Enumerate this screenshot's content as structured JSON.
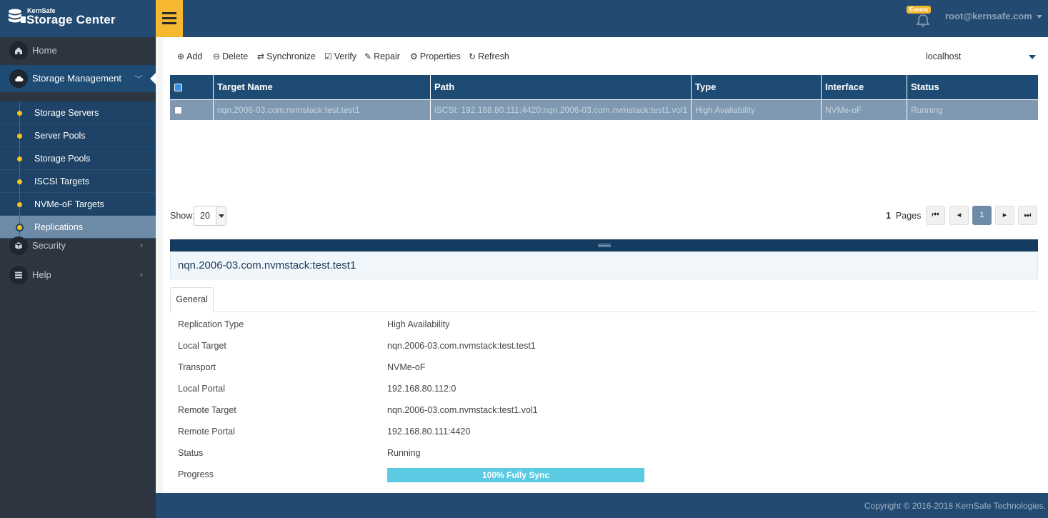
{
  "brand": {
    "small": "KernSafe",
    "title": "Storage Center"
  },
  "header": {
    "events_label": "Events",
    "user": "root@kernsafe.com"
  },
  "sidebar": {
    "items": [
      {
        "label": "Home",
        "icon": "home-icon"
      },
      {
        "label": "Storage Management",
        "icon": "cloud-icon"
      },
      {
        "label": "Security",
        "icon": "cube-icon"
      },
      {
        "label": "Help",
        "icon": "list-icon"
      }
    ],
    "subitems": [
      {
        "label": "Storage Servers"
      },
      {
        "label": "Server Pools"
      },
      {
        "label": "Storage Pools"
      },
      {
        "label": "ISCSI Targets"
      },
      {
        "label": "NVMe-oF Targets"
      },
      {
        "label": "Replications"
      }
    ]
  },
  "toolbar": {
    "add": "Add",
    "delete": "Delete",
    "synchronize": "Synchronize",
    "verify": "Verify",
    "repair": "Repair",
    "properties": "Properties",
    "refresh": "Refresh",
    "host": "localhost"
  },
  "table": {
    "columns": [
      "Target Name",
      "Path",
      "Type",
      "Interface",
      "Status"
    ],
    "rows": [
      {
        "target_name": "nqn.2006-03.com.nvmstack:test.test1",
        "path": "iSCSI: 192.168.80.111:4420:nqn.2006-03.com.nvmstack:test1.vol1",
        "type": "High Availability",
        "interface": "NVMe-oF",
        "status": "Running"
      }
    ]
  },
  "pager": {
    "show_label": "Show:",
    "page_size": "20",
    "page_count": "1",
    "pages_label": "Pages",
    "current_page": "1"
  },
  "detail": {
    "title": "nqn.2006-03.com.nvmstack:test.test1",
    "tab": "General",
    "props": [
      {
        "k": "Replication Type",
        "v": "High Availability"
      },
      {
        "k": "Local Target",
        "v": "nqn.2006-03.com.nvmstack:test.test1"
      },
      {
        "k": "Transport",
        "v": "NVMe-oF"
      },
      {
        "k": "Local Portal",
        "v": "192.168.80.112:0"
      },
      {
        "k": "Remote Target",
        "v": "nqn.2006-03.com.nvmstack:test1.vol1"
      },
      {
        "k": "Remote Portal",
        "v": "192.168.80.111:4420"
      },
      {
        "k": "Status",
        "v": "Running"
      }
    ],
    "progress_label": "Progress",
    "progress_text": "100% Fully Sync",
    "progress_percent": 100
  },
  "footer": {
    "copyright": "Copyright © 2016-2018 KernSafe Technologies."
  },
  "colors": {
    "header": "#234a70",
    "accent": "#f5b82e",
    "table_head": "#1d4b74",
    "selected_row": "#7f99b2",
    "progress": "#5bcbe3"
  }
}
